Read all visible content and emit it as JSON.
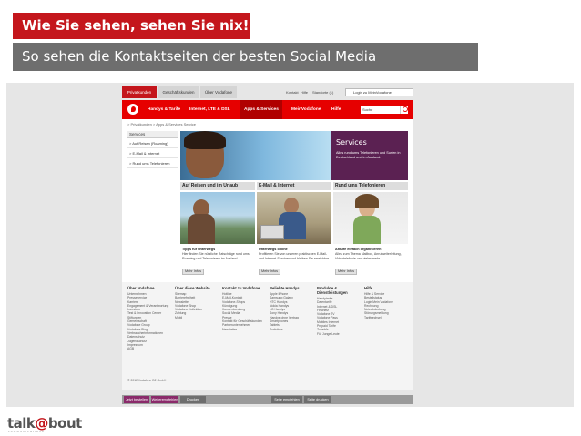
{
  "title": "Wie Sie sehen, sehen Sie nix!",
  "subtitle": "So sehen die Kontaktseiten der besten Social Media",
  "screenshot": {
    "top_tabs": [
      "Privatkunden",
      "Geschäftskunden",
      "Über Vodafone"
    ],
    "util_links": [
      "Kontakt",
      "Hilfe",
      "Standorte (1)"
    ],
    "login_label": "Login zu MeinVodafone",
    "nav": [
      "Handys & Tarife",
      "Internet, LTE & DSL",
      "Apps & Services",
      "MeinVodafone",
      "Hilfe"
    ],
    "search_placeholder": "Suche",
    "breadcrumb": "> Privatkunden  > Apps & Services  Service",
    "sidebar": {
      "heading": "Services",
      "items": [
        "> Auf Reisen (Roaming)",
        "> E-Mail & Internet",
        "> Rund ums Telefonieren"
      ]
    },
    "services_box": {
      "title": "Services",
      "text": "Alles rund ums Telefonieren und Surfen in Deutschland und im Ausland."
    },
    "columns": [
      {
        "heading": "Auf Reisen und im Urlaub",
        "strong": "Tipps für unterwegs",
        "text": "Hier finden Sie nützliche Ratschläge rund ums Roaming und Telefonieren im Ausland.",
        "button": "Mehr Infos"
      },
      {
        "heading": "E-Mail & Internet",
        "strong": "Unterwegs online",
        "text": "Profitieren Sie von unseren praktischen E-Mail- und Internet-Services und bleiben Sie erreichbar.",
        "button": "Mehr Infos"
      },
      {
        "heading": "Rund ums Telefonieren",
        "strong": "Anrufe einfach organisieren",
        "text": "Alles zum Thema Mailbox, Anrufweiterleitung, Videotelefonie und vieles mehr.",
        "button": "Mehr Infos"
      }
    ],
    "footer": [
      {
        "heading": "Über Vodafone",
        "links": [
          "Unternehmen",
          "Presseservice",
          "Karriere",
          "Engagement & Verantwortung",
          "Investors",
          "Test & Innovation Center",
          "Stiftungen",
          "Gemeinschaft",
          "Vodafone Group",
          "Vodafone Blog",
          "Verbraucherinformationen",
          "Datenschutz",
          "Jugendschutz",
          "Impressum",
          "AGB"
        ]
      },
      {
        "heading": "Über diese Website",
        "links": [
          "Sitemap",
          "Barrierefreiheit",
          "Newsletter",
          "Vodafone Shop",
          "Vodafone Kollektion",
          "Zahlung",
          "Mobil"
        ]
      },
      {
        "heading": "Kontakt zu Vodafone",
        "links": [
          "Hotline",
          "E-Mail-Kontakt",
          "Vodafone-Shops",
          "Kündigung",
          "Kundenberatung",
          "Social Media",
          "Presse",
          "Kontakt für Geschäftskunden",
          "Partnerunternehmen",
          "Newsletter"
        ]
      },
      {
        "heading": "Beliebte Handys",
        "links": [
          "Apple iPhone",
          "Samsung Galaxy",
          "HTC Handys",
          "Nokia Handys",
          "LG Handys",
          "Sony Handys",
          "Handys ohne Vertrag",
          "Smartphones",
          "Tablets",
          "Surfsticks"
        ]
      },
      {
        "heading": "Produkte & Dienstleistungen",
        "links": [
          "Handytarife",
          "Datentarife",
          "Internet & DSL",
          "Festnetz",
          "Vodafone TV",
          "Vodafone Pass",
          "Mobiles Internet",
          "Prepaid Tarife",
          "Zubehör",
          "Für Junge Leute"
        ]
      },
      {
        "heading": "Hilfe",
        "links": [
          "Hilfe & Service",
          "Bestellstatus",
          "Login Mein Vodafone",
          "Rechnung",
          "Netzabdeckung",
          "Störungsmeldung",
          "Tarifwechsel"
        ]
      }
    ],
    "copyright": "© 2012 Vodafone D2 GmbH",
    "bottom_bar": [
      "Jetzt bestellen",
      "Weiterempfehlen",
      "Drucken",
      "Seite empfehlen",
      "Seite drucken"
    ]
  },
  "brand": {
    "pre": "talk",
    "at": "@",
    "post": "bout",
    "sub": "communications"
  },
  "colors": {
    "brand_red": "#c4161c",
    "vodafone_red": "#e60000",
    "services_purple": "#5b2152",
    "subtitle_gray": "#6e6e6e"
  }
}
